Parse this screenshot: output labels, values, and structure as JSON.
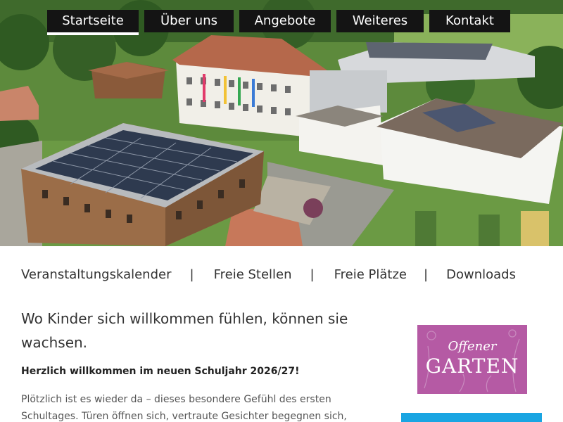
{
  "nav": {
    "items": [
      {
        "label": "Startseite",
        "active": true
      },
      {
        "label": "Über uns"
      },
      {
        "label": "Angebote"
      },
      {
        "label": "Weiteres"
      },
      {
        "label": "Kontakt"
      }
    ]
  },
  "subnav": {
    "items": [
      "Veranstaltungskalender",
      "Freie Stellen",
      "Freie Plätze",
      "Downloads"
    ],
    "separator": "|"
  },
  "main": {
    "headline": "Wo Kinder sich willkommen fühlen, können sie wachsen.",
    "welcome": "Herzlich willkommen im neuen Schuljahr 2026/27!",
    "paragraph": "Plötzlich ist es wieder da – dieses besondere Gefühl des ersten Schultages. Türen öffnen sich, vertraute Gesichter begegnen sich, neue Menschen"
  },
  "sidebar": {
    "promo_line1": "Offener",
    "promo_line2": "GARTEN"
  },
  "colors": {
    "nav_bg": "#141414",
    "promo_bg": "#b55aa4",
    "accent_blue": "#1aa5e2"
  }
}
